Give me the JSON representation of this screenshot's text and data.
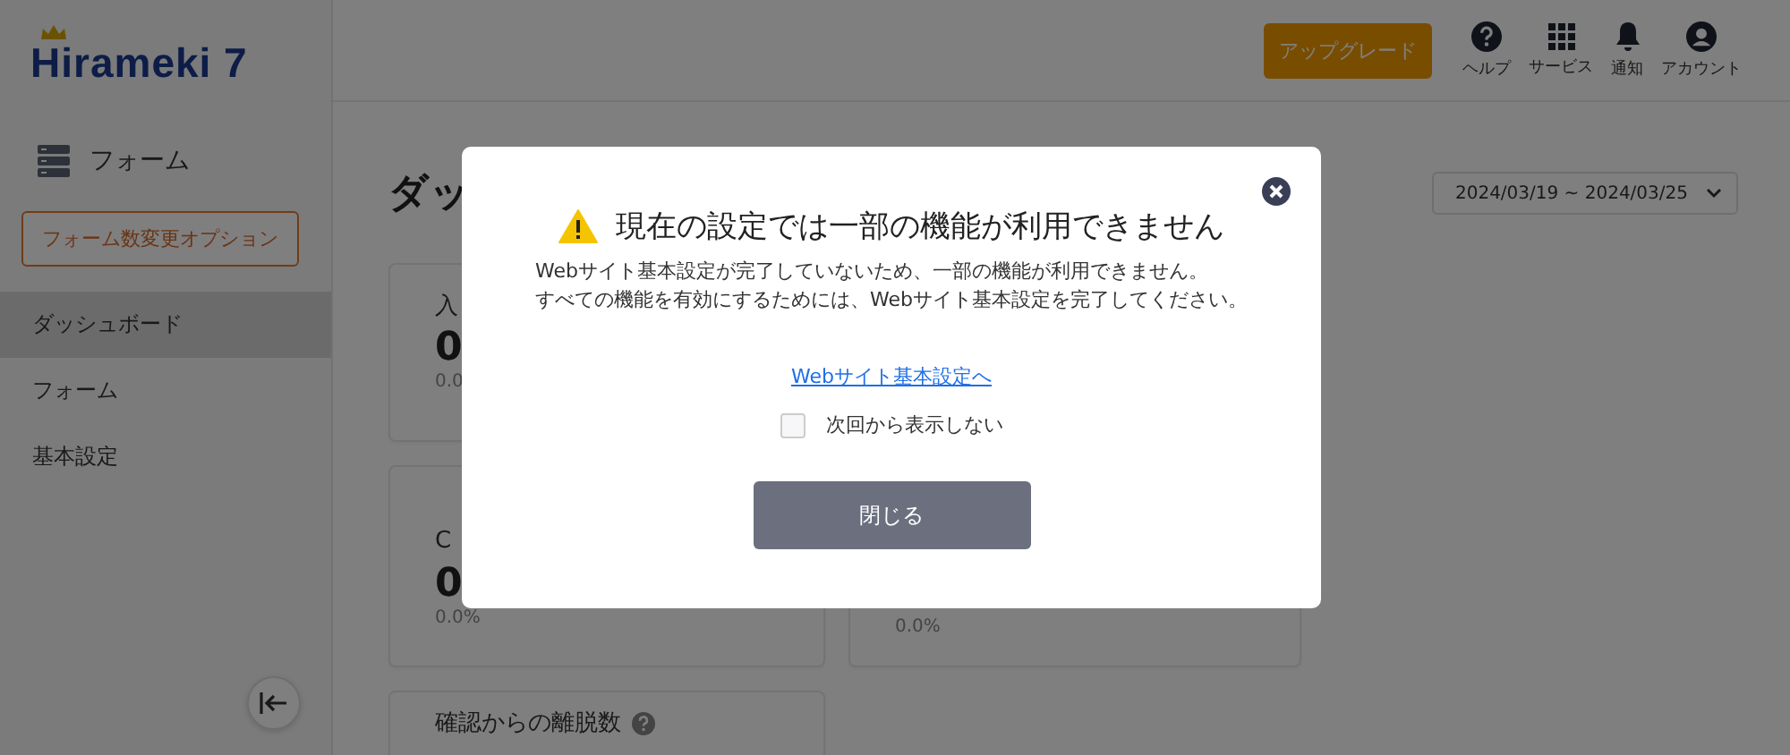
{
  "logo": {
    "text": "Hirameki 7"
  },
  "sidebar": {
    "section": "フォーム",
    "option_button": "フォーム数変更オプション",
    "items": [
      {
        "label": "ダッシュボード",
        "selected": true
      },
      {
        "label": "フォーム",
        "selected": false
      },
      {
        "label": "基本設定",
        "selected": false
      }
    ]
  },
  "header": {
    "upgrade_button": "アップグレード",
    "actions": [
      {
        "kind": "help",
        "label": "ヘルプ"
      },
      {
        "kind": "services",
        "label": "サービス"
      },
      {
        "kind": "notifications",
        "label": "通知"
      },
      {
        "kind": "account",
        "label": "アカウント"
      }
    ]
  },
  "page": {
    "title": "ダッ",
    "date_range": "2024/03/19 ~ 2024/03/25",
    "cards": [
      {
        "label": "入",
        "value": "0",
        "rate": "0.0"
      },
      {
        "label": "C",
        "value": "0",
        "rate": "0.0%"
      },
      {
        "rate": "0.0%"
      },
      {
        "label": "確認からの離脱数",
        "help": true
      }
    ]
  },
  "modal": {
    "title": "現在の設定では一部の機能が利用できません",
    "message": [
      "Webサイト基本設定が完了していないため、一部の機能が利用できません。",
      "すべての機能を有効にするためには、Webサイト基本設定を完了してください。"
    ],
    "link": "Webサイト基本設定へ",
    "checkbox": {
      "label": "次回から表示しない",
      "checked": false
    },
    "close_button": "閉じる"
  }
}
